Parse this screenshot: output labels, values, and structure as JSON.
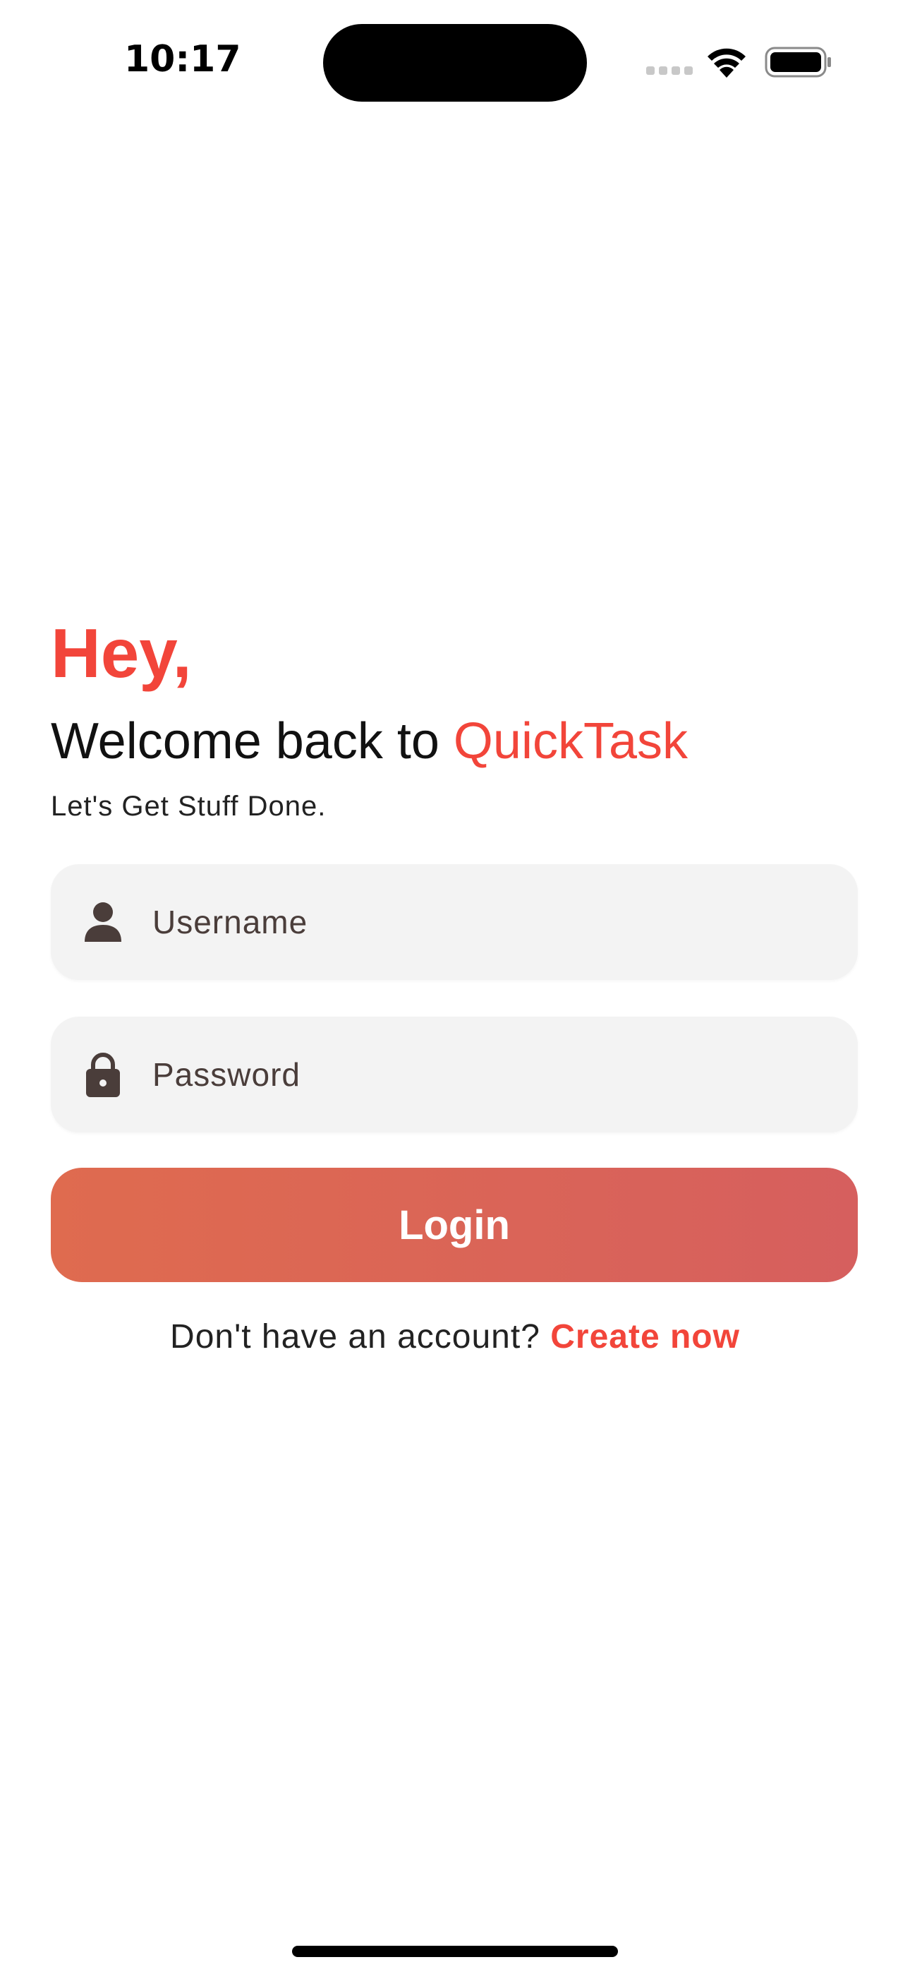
{
  "status_bar": {
    "time": "10:17",
    "icons": [
      "signal-icon",
      "wifi-icon",
      "battery-icon"
    ]
  },
  "greeting": {
    "hey": "Hey,",
    "welcome_prefix": "Welcome back to ",
    "app_name": "QuickTask",
    "tagline": "Let's Get Stuff Done."
  },
  "form": {
    "username_placeholder": "Username",
    "username_icon": "person-icon",
    "password_placeholder": "Password",
    "password_icon": "lock-icon",
    "login_label": "Login"
  },
  "signup": {
    "prompt": "Don't have an account? ",
    "link": "Create now"
  },
  "colors": {
    "accent": "#f2453a",
    "button_gradient_start": "#df6b4f",
    "button_gradient_end": "#d65f5e",
    "field_background": "#f3f3f3",
    "icon_color": "#4a3d3a"
  }
}
